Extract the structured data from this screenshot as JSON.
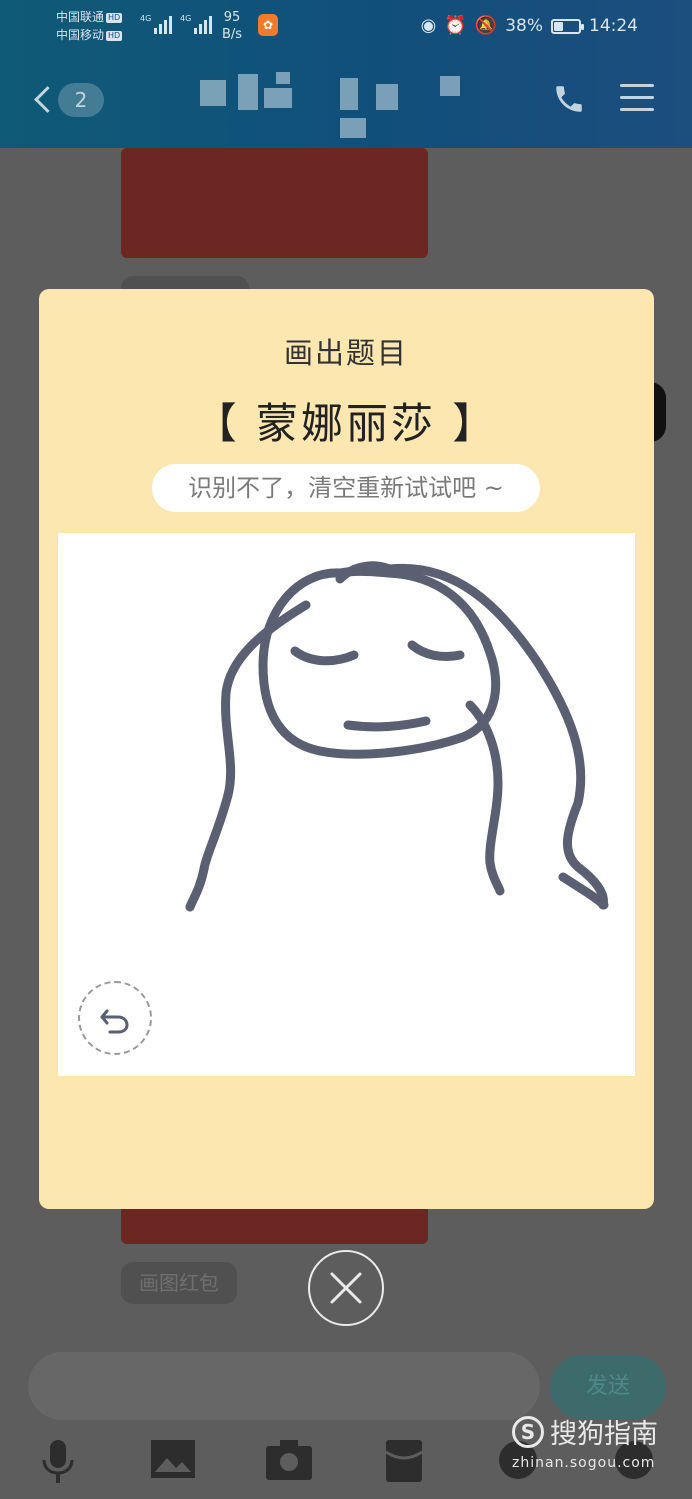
{
  "status_bar": {
    "carrier1": "中国联通",
    "carrier2": "中国移动",
    "hd": "HD",
    "net1": "4G",
    "net2": "4G",
    "speed_value": "95",
    "speed_unit": "B/s",
    "battery": "38%",
    "battery_level": 0.38,
    "time": "14:24",
    "icons": [
      "eye-icon",
      "alarm-icon",
      "mute-bell-icon",
      "battery-icon"
    ]
  },
  "header": {
    "back_count": "2",
    "title_obscured": true,
    "icons": [
      "back-icon",
      "phone-icon",
      "menu-icon"
    ]
  },
  "modal": {
    "title": "画出题目",
    "word": "【 蒙娜丽莎 】",
    "hint": "识别不了，清空重新试试吧 ~",
    "undo_icon": "undo-icon",
    "close_icon": "close-icon"
  },
  "chat": {
    "chip_label": "画图红包",
    "send_label": "发送",
    "tools": [
      "microphone-icon",
      "image-icon",
      "camera-icon",
      "red-packet-icon",
      "emoji-icon",
      "plus-icon"
    ]
  },
  "watermark": {
    "brand": "搜狗指南",
    "url": "zhinan.sogou.com"
  },
  "colors": {
    "header_bg": "#125478",
    "modal_bg": "#fce7b1",
    "stroke": "#5a5f72",
    "red_card": "#6d2722"
  }
}
